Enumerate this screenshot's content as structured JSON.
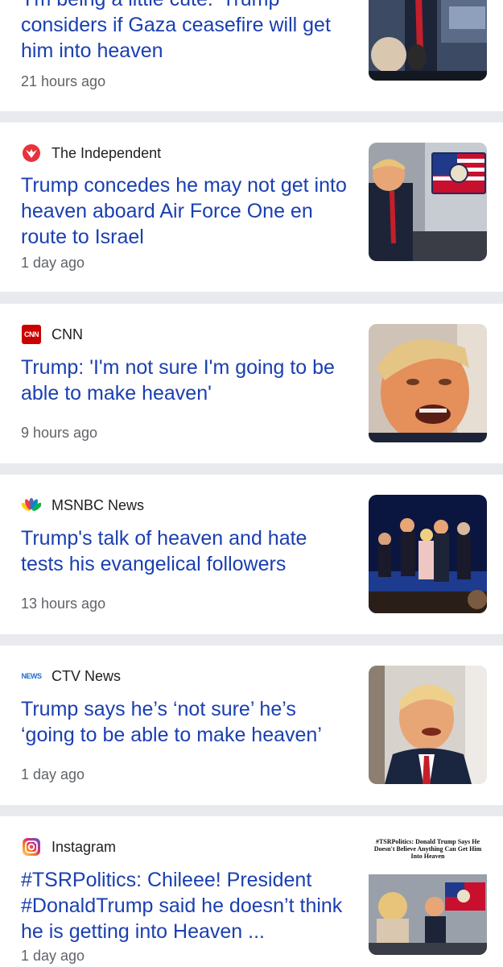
{
  "articles": [
    {
      "source": "",
      "headline": "'I'm being a little cute.' Trump considers if Gaza ceasefire will get him into heaven",
      "time": "21 hours ago",
      "thumb_icon": "trump-press-photo"
    },
    {
      "source": "The Independent",
      "source_icon": "independent-eagle-icon",
      "headline": "Trump concedes he may not get into heaven aboard Air Force One en route to Israel",
      "time": "1 day ago",
      "thumb_icon": "trump-air-force-one-photo"
    },
    {
      "source": "CNN",
      "source_icon": "cnn-logo-icon",
      "source_logo_text": "CNN",
      "headline": "Trump: 'I'm not sure I'm going to be able to make heaven'",
      "time": "9 hours ago",
      "thumb_icon": "trump-closeup-photo"
    },
    {
      "source": "MSNBC News",
      "source_icon": "nbc-peacock-icon",
      "headline": "Trump's talk of heaven and hate tests his evangelical followers",
      "time": "13 hours ago",
      "thumb_icon": "stage-group-photo"
    },
    {
      "source": "CTV News",
      "source_icon": "ctv-news-icon",
      "source_logo_text": "NEWS",
      "headline": "Trump says he’s ‘not sure’ he’s ‘going to be able to make heaven’",
      "time": "1 day ago",
      "thumb_icon": "trump-smiling-photo"
    },
    {
      "source": "Instagram",
      "source_icon": "instagram-icon",
      "headline": "#TSRPolitics: Chileee! President #DonaldTrump said he doesn’t think he is getting into Heaven ...",
      "time": "1 day ago",
      "thumb_icon": "tsr-post-photo",
      "thumb_caption": "#TSRPolitics: Donald Trump Says He Doesn't Believe Anything Can Get Him Into Heaven"
    }
  ],
  "colors": {
    "headline": "#1a3fb0",
    "source_text": "#202124",
    "time_text": "#5f6368",
    "divider": "#e9eaee",
    "cnn_red": "#cc0000",
    "independent_red": "#e8323c"
  }
}
